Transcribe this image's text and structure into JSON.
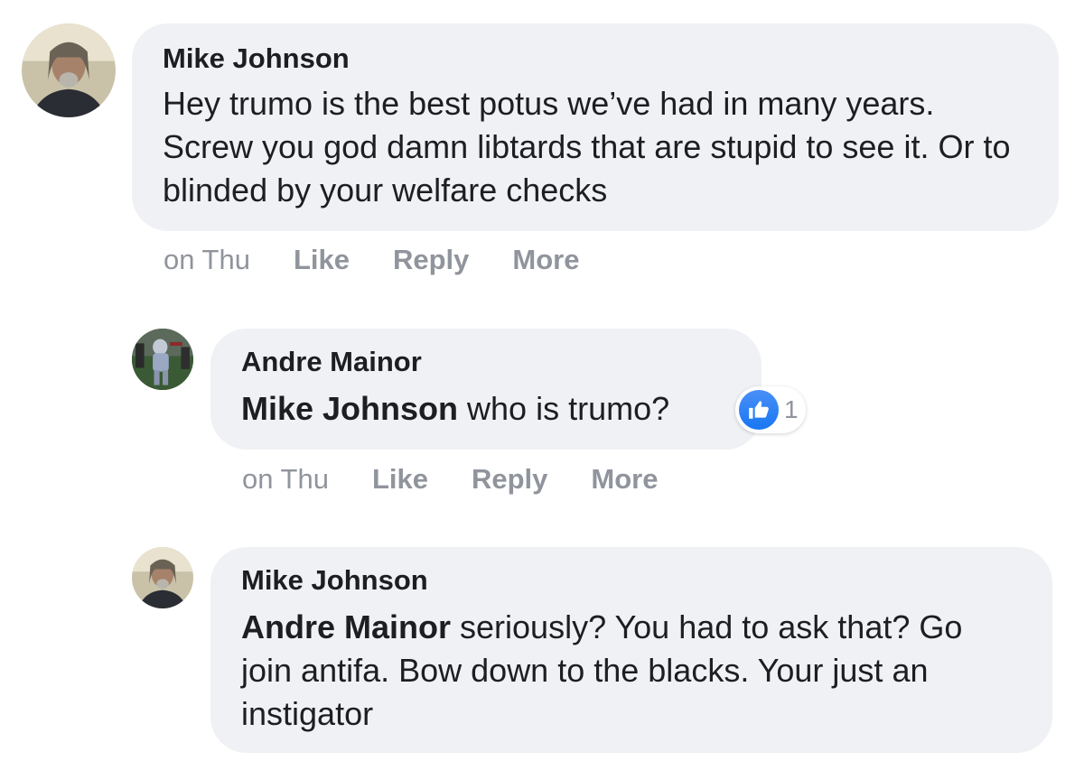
{
  "comments": [
    {
      "author": "Mike Johnson",
      "mention": "",
      "text": "Hey trumo is the best potus we’ve had in many years. Screw you god damn libtards that are stupid to see it. Or to blinded by your welfare checks",
      "timestamp": "on Thu",
      "actions": [
        "Like",
        "Reply",
        "More"
      ]
    },
    {
      "author": "Andre Mainor",
      "mention": "Mike Johnson",
      "text": " who is trumo?",
      "timestamp": "on Thu",
      "actions": [
        "Like",
        "Reply",
        "More"
      ],
      "reaction": {
        "icon": "thumbs-up-icon",
        "count": "1"
      }
    },
    {
      "author": "Mike Johnson",
      "mention": "Andre Mainor",
      "text": " seriously? You had to ask that? Go join antifa. Bow down to the blacks. Your just an instigator"
    }
  ],
  "colors": {
    "bubble": "#f0f1f5",
    "meta": "#90949c",
    "like_blue": "#1877f2"
  }
}
